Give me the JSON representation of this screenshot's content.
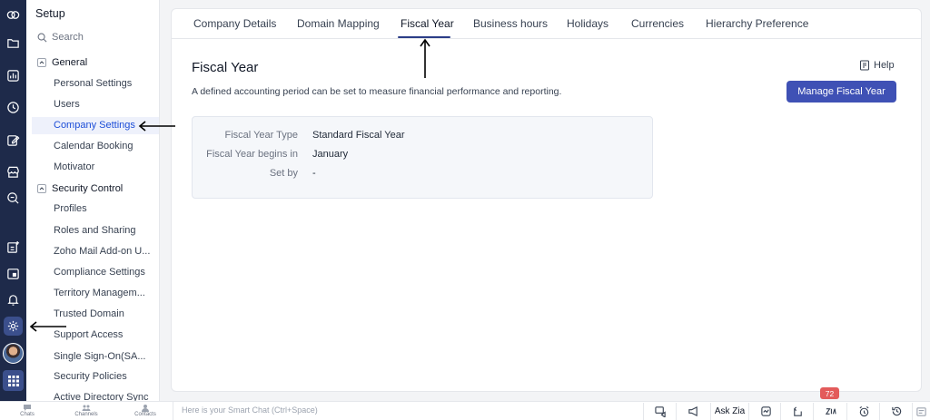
{
  "rail": {
    "icons": [
      "zoho-logo-icon",
      "folder-icon",
      "analytics-icon",
      "clock-icon",
      "edit-icon",
      "store-icon",
      "search-report-icon",
      "add-note-icon",
      "calendar-icon",
      "bell-icon",
      "gear-icon"
    ],
    "active": "gear-icon"
  },
  "setup": {
    "title": "Setup",
    "search_placeholder": "Search",
    "groups": [
      {
        "label": "General",
        "items": [
          "Personal Settings",
          "Users",
          "Company Settings",
          "Calendar Booking",
          "Motivator"
        ]
      },
      {
        "label": "Security Control",
        "items": [
          "Profiles",
          "Roles and Sharing",
          "Zoho Mail Add-on U...",
          "Compliance Settings",
          "Territory Managem...",
          "Trusted Domain",
          "Support Access",
          "Single Sign-On(SA...",
          "Security Policies",
          "Active Directory Sync"
        ]
      }
    ],
    "active_item": "Company Settings"
  },
  "tabs": [
    "Company Details",
    "Domain Mapping",
    "Fiscal Year",
    "Business hours",
    "Holidays",
    "Currencies",
    "Hierarchy Preference"
  ],
  "active_tab": "Fiscal Year",
  "main": {
    "title": "Fiscal Year",
    "description": "A defined accounting period can be set to measure financial performance and reporting.",
    "help_label": "Help",
    "manage_button": "Manage Fiscal Year",
    "fields": [
      {
        "label": "Fiscal Year Type",
        "value": "Standard Fiscal Year"
      },
      {
        "label": "Fiscal Year begins in",
        "value": "January"
      },
      {
        "label": "Set by",
        "value": "-"
      }
    ]
  },
  "bottom": {
    "nav": [
      "Chats",
      "Channels",
      "Contacts"
    ],
    "smart_chat_placeholder": "Here is your Smart Chat (Ctrl+Space)",
    "ask_zia": "Ask Zia",
    "notification_count": "72"
  },
  "colors": {
    "rail_bg": "#1e2a4a",
    "accent": "#3f51b5",
    "active_tab_underline": "#2b3d87",
    "badge": "#e35b5b"
  }
}
